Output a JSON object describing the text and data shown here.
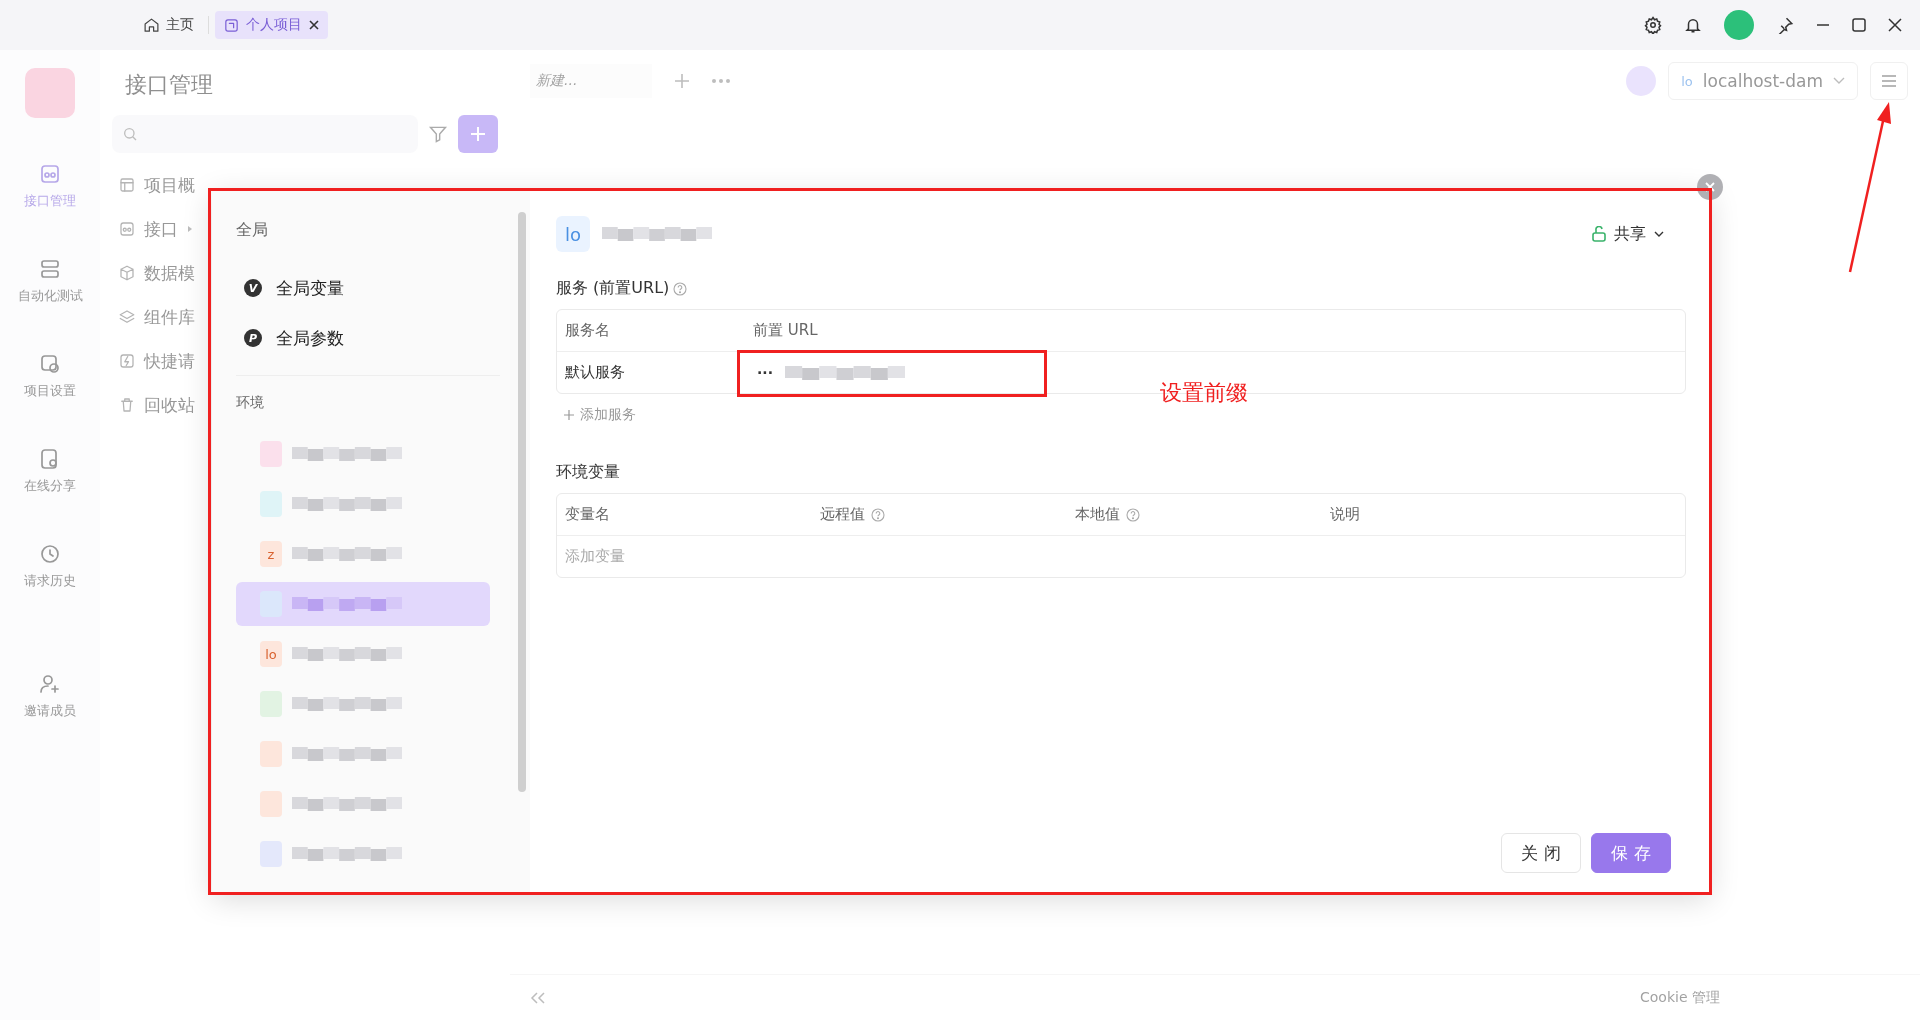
{
  "titlebar": {
    "tabs": [
      {
        "label": "主页",
        "selected": false,
        "closable": false
      },
      {
        "label": "个人项目",
        "selected": true,
        "closable": true
      }
    ]
  },
  "sidebar": {
    "items": [
      {
        "label": "接口管理",
        "selected": true
      },
      {
        "label": "自动化测试",
        "selected": false
      },
      {
        "label": "项目设置",
        "selected": false
      },
      {
        "label": "在线分享",
        "selected": false
      },
      {
        "label": "请求历史",
        "selected": false
      },
      {
        "label": "邀请成员",
        "selected": false
      }
    ]
  },
  "nav": {
    "title": "接口管理",
    "items": [
      {
        "label": "项目概",
        "expandable": false
      },
      {
        "label": "接口",
        "expandable": true
      },
      {
        "label": "数据模",
        "expandable": false
      },
      {
        "label": "组件库",
        "expandable": false
      },
      {
        "label": "快捷请",
        "expandable": false
      },
      {
        "label": "回收站",
        "expandable": false
      }
    ]
  },
  "main": {
    "tabs": [
      {
        "label": "新建..."
      }
    ],
    "environment": {
      "badge": "lo",
      "value": "localhost-dam"
    },
    "footer": {
      "cookie": "Cookie 管理"
    }
  },
  "modal": {
    "global": {
      "heading": "全局",
      "items": [
        {
          "badge": "V",
          "label": "全局变量"
        },
        {
          "badge": "P",
          "label": "全局参数"
        }
      ]
    },
    "environments": {
      "heading": "环境",
      "items": [
        {
          "color": "#fbe0ec",
          "selected": false
        },
        {
          "color": "#dff4f7",
          "selected": false
        },
        {
          "badge": "z",
          "color": "#fde6dc",
          "selected": false
        },
        {
          "color": "#dbe7fb",
          "selected": true
        },
        {
          "badge": "lo",
          "color": "#fde6dc",
          "selected": false
        },
        {
          "color": "#e2f3e3",
          "selected": false
        },
        {
          "color": "#fde6dc",
          "selected": false
        },
        {
          "color": "#fde6dc",
          "selected": false
        },
        {
          "color": "#e4e8fb",
          "selected": false
        }
      ]
    },
    "env_badge": "lo",
    "share": "共享",
    "services": {
      "title": "服务 (前置URL)",
      "columns": [
        "服务名",
        "前置 URL"
      ],
      "rows": [
        {
          "name": "默认服务",
          "menu": "···"
        }
      ],
      "add": "添加服务"
    },
    "variables": {
      "title": "环境变量",
      "columns": [
        {
          "label": "变量名",
          "help": false
        },
        {
          "label": "远程值",
          "help": true
        },
        {
          "label": "本地值",
          "help": true
        },
        {
          "label": "说明",
          "help": false
        }
      ],
      "placeholder": "添加变量"
    },
    "buttons": [
      {
        "label": "关 闭",
        "kind": "secondary"
      },
      {
        "label": "保 存",
        "kind": "primary"
      }
    ]
  },
  "annotation": {
    "text": "设置前缀"
  }
}
